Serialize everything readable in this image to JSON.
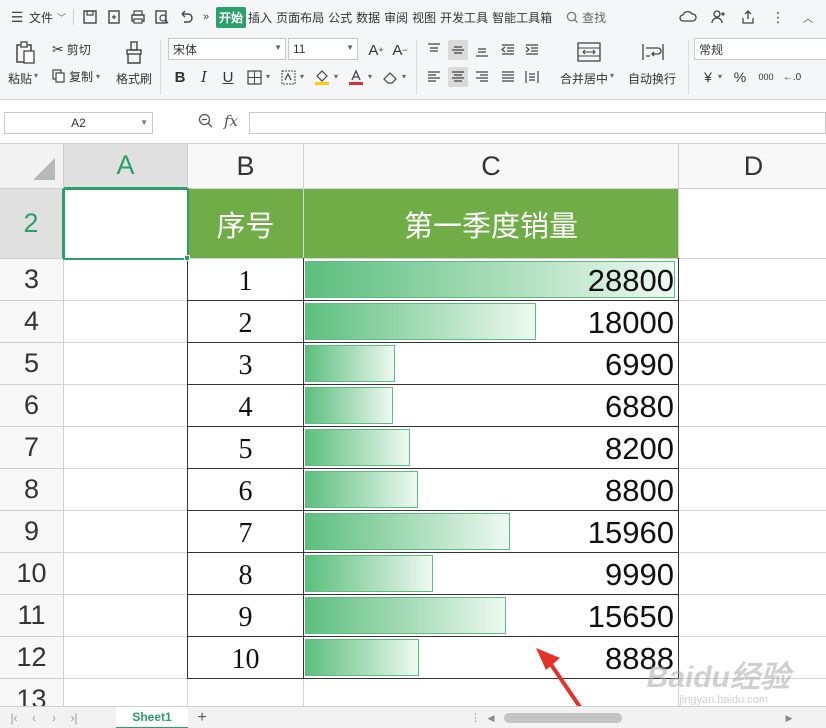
{
  "menubar": {
    "file_label": "文件",
    "tabs": [
      "开始",
      "插入",
      "页面布局",
      "公式",
      "数据",
      "审阅",
      "视图",
      "开发工具",
      "智能工具箱"
    ],
    "active_tab": "开始",
    "search_label": "查找"
  },
  "ribbon": {
    "paste_label": "粘贴",
    "cut_label": "剪切",
    "copy_label": "复制",
    "format_painter_label": "格式刷",
    "font_name": "宋体",
    "font_size": "11",
    "merge_center_label": "合并居中",
    "wrap_text_label": "自动换行",
    "number_format": "常规",
    "currency_symbol": "¥",
    "percent_symbol": "%",
    "thousands_symbol": "000",
    "bold_label": "B",
    "italic_label": "I",
    "underline_label": "U"
  },
  "formula_bar": {
    "name_box": "A2",
    "fx_label": "fx",
    "formula": ""
  },
  "grid": {
    "columns": [
      "A",
      "B",
      "C",
      "D"
    ],
    "selected_column": "A",
    "rows": [
      "2",
      "3",
      "4",
      "5",
      "6",
      "7",
      "8",
      "9",
      "10",
      "11",
      "12",
      "13"
    ],
    "selected_row": "2",
    "header": {
      "seq": "序号",
      "sales": "第一季度销量"
    },
    "records": [
      {
        "seq": "1",
        "value": "28800",
        "bar_fraction": 1.0
      },
      {
        "seq": "2",
        "value": "18000",
        "bar_fraction": 0.625
      },
      {
        "seq": "3",
        "value": "6990",
        "bar_fraction": 0.243
      },
      {
        "seq": "4",
        "value": "6880",
        "bar_fraction": 0.239
      },
      {
        "seq": "5",
        "value": "8200",
        "bar_fraction": 0.285
      },
      {
        "seq": "6",
        "value": "8800",
        "bar_fraction": 0.306
      },
      {
        "seq": "7",
        "value": "15960",
        "bar_fraction": 0.554
      },
      {
        "seq": "8",
        "value": "9990",
        "bar_fraction": 0.347
      },
      {
        "seq": "9",
        "value": "15650",
        "bar_fraction": 0.543
      },
      {
        "seq": "10",
        "value": "8888",
        "bar_fraction": 0.309
      }
    ],
    "header_fill": "#70ad47",
    "databar_color": "#5cbf7d"
  },
  "sheets": {
    "active": "Sheet1"
  },
  "watermark": {
    "brand": "Baidu经验",
    "url": "jingyan.baidu.com"
  },
  "colors": {
    "accent": "#2aa06b",
    "annotation_arrow": "#e8302b"
  }
}
